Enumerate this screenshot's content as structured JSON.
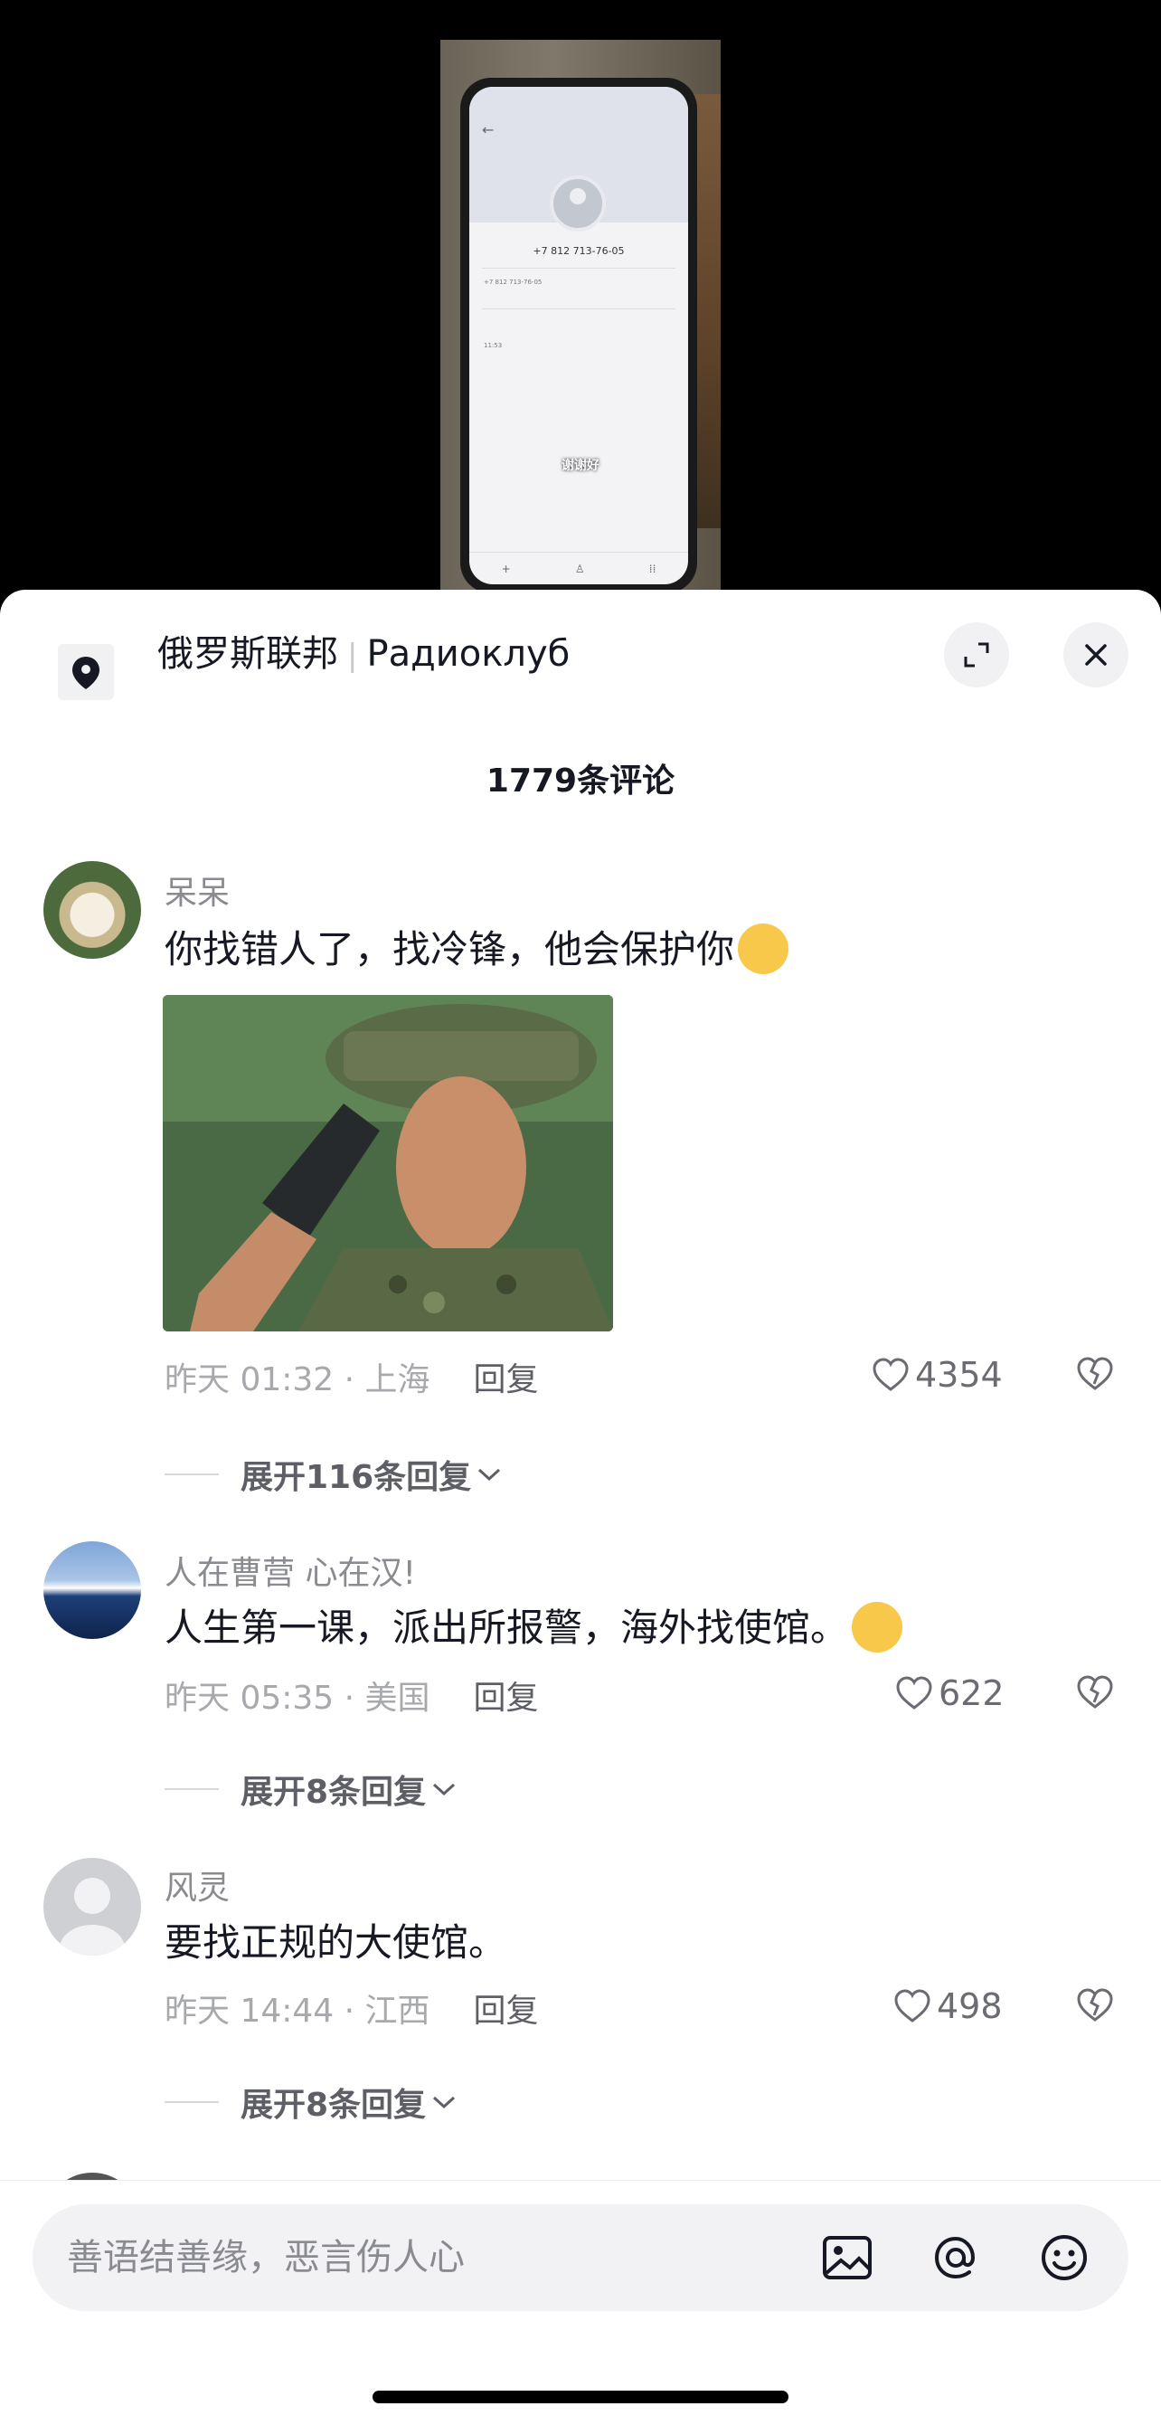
{
  "video": {
    "phone_number_display": "+7 812 713-76-05",
    "phone_number_small": "+7 812 713-76-05",
    "phone_time": "11:53",
    "subtitle": "谢谢好"
  },
  "panel": {
    "location_name": "俄罗斯联邦",
    "location_sub": "Радиоклуб",
    "comment_count_label": "1779条评论"
  },
  "comments": [
    {
      "username": "呆呆",
      "text": "你找错人了，找冷锋，他会保护你",
      "emoji": "thinking-face",
      "time": "昨天 01:32 · 上海",
      "reply_label": "回复",
      "likes": "4354",
      "expand_label": "展开116条回复"
    },
    {
      "username": "人在曹营  心在汉!",
      "text": "人生第一课，派出所报警，海外找使馆。",
      "emoji": "rolling-laughing-face",
      "time": "昨天 05:35 · 美国",
      "reply_label": "回复",
      "likes": "622",
      "expand_label": "展开8条回复"
    },
    {
      "username": "风灵",
      "text": "要找正规的大使馆。",
      "time": "昨天 14:44 · 江西",
      "reply_label": "回复",
      "likes": "498",
      "expand_label": "展开8条回复"
    }
  ],
  "input": {
    "placeholder": "善语结善缘，恶言伤人心"
  },
  "colors": {
    "text_primary": "#161823",
    "text_secondary": "#8a8b91",
    "panel_bg": "#ffffff",
    "input_bg": "#f2f2f4"
  }
}
